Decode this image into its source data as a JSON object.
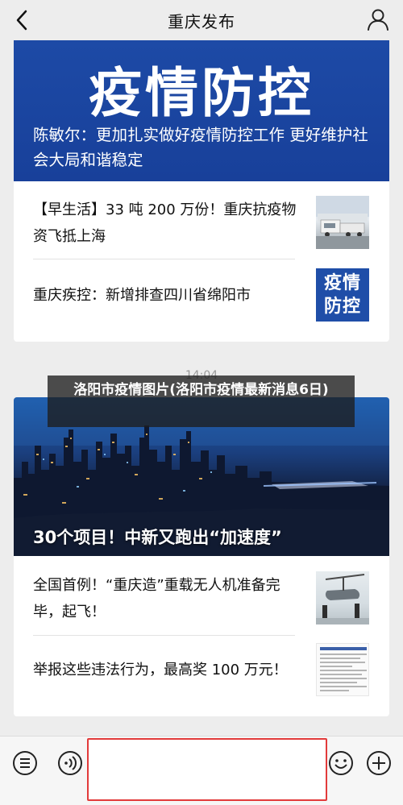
{
  "header": {
    "title": "重庆发布",
    "back_icon": "chevron-left-icon",
    "user_icon": "user-icon"
  },
  "card1": {
    "banner_title": "疫情防控",
    "banner_subtitle": "陈敏尔：更加扎实做好疫情防控工作 更好维护社会大局和谐稳定",
    "items": [
      {
        "title": "【早生活】33 吨 200 万份！重庆抗疫物资飞抵上海",
        "thumb": "truck-photo"
      },
      {
        "title": "重庆疾控：新增排查四川省绵阳市",
        "thumb": "epidemic-badge",
        "thumb_text": "疫情防控"
      }
    ]
  },
  "timestamp": "14:04",
  "overlay_headline": "洛阳市疫情图片(洛阳市疫情最新消息6日)",
  "card2": {
    "banner_caption": "30个项目！中新又跑出“加速度”",
    "items": [
      {
        "title": "全国首例！“重庆造”重载无人机准备完毕，起飞！",
        "thumb": "drone-photo"
      },
      {
        "title": "举报这些违法行为，最高奖 100 万元！",
        "thumb": "document-image"
      }
    ]
  },
  "bottom_bar": {
    "menu_icon": "menu-icon",
    "voice_icon": "voice-icon",
    "emoji_icon": "emoji-icon",
    "add_icon": "plus-icon",
    "input_placeholder": ""
  },
  "colors": {
    "brand_blue": "#1d4aa6",
    "highlight_red": "#e23a3a",
    "background": "#ededed"
  }
}
